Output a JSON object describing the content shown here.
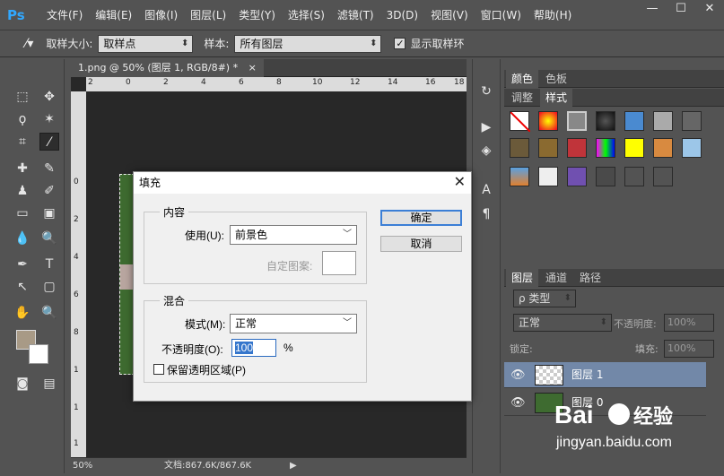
{
  "app": {
    "logo": "Ps",
    "menus": [
      "文件(F)",
      "编辑(E)",
      "图像(I)",
      "图层(L)",
      "类型(Y)",
      "选择(S)",
      "滤镜(T)",
      "3D(D)",
      "视图(V)",
      "窗口(W)",
      "帮助(H)"
    ]
  },
  "window_buttons": {
    "minimize": "—",
    "maximize": "☐",
    "close": "✕"
  },
  "options": {
    "sample_size_label": "取样大小:",
    "sample_size_value": "取样点",
    "sample_label": "样本:",
    "sample_value": "所有图层",
    "show_ring_label": "显示取样环",
    "show_ring_checked": true
  },
  "document": {
    "tab_title": "1.png @ 50% (图层 1, RGB/8#) *",
    "close": "×",
    "ruler_h": [
      "2",
      "0",
      "2",
      "4",
      "6",
      "8",
      "10",
      "12",
      "14",
      "16",
      "18"
    ],
    "ruler_v": [
      "0",
      "2",
      "4",
      "6",
      "8",
      "1",
      "1",
      "1"
    ],
    "zoom": "50%",
    "doc_info": "文档:867.6K/867.6K"
  },
  "panels": {
    "color_tabs": [
      "颜色",
      "色板"
    ],
    "style_tabs": [
      "调整",
      "样式"
    ],
    "layer_tabs": [
      "图层",
      "通道",
      "路径"
    ],
    "filter_kind": "ρ 类型",
    "blend_mode": "正常",
    "opacity_label": "不透明度:",
    "opacity_value": "100%",
    "lock_label": "锁定:",
    "fill_label": "填充:",
    "fill_value": "100%",
    "layers": [
      {
        "name": "图层 1",
        "selected": true
      },
      {
        "name": "图层 0",
        "selected": false
      }
    ]
  },
  "dialog": {
    "title": "填充",
    "close": "✕",
    "content_group": "内容",
    "use_label": "使用(U):",
    "use_value": "前景色",
    "custom_pattern_label": "自定图案:",
    "blend_group": "混合",
    "mode_label": "模式(M):",
    "mode_value": "正常",
    "opacity_label": "不透明度(O):",
    "opacity_value": "100",
    "opacity_unit": "%",
    "preserve_label": "保留透明区域(P)",
    "ok": "确定",
    "cancel": "取消"
  },
  "watermark": {
    "brand": "Bai",
    "brand2": "经验",
    "url": "jingyan.baidu.com"
  },
  "colors": {
    "panel_bg": "#535353",
    "canvas_bg": "#282828",
    "selected_layer": "#7288a8",
    "dialog_bg": "#f0f0f0",
    "ps_blue": "#31a8ff"
  }
}
